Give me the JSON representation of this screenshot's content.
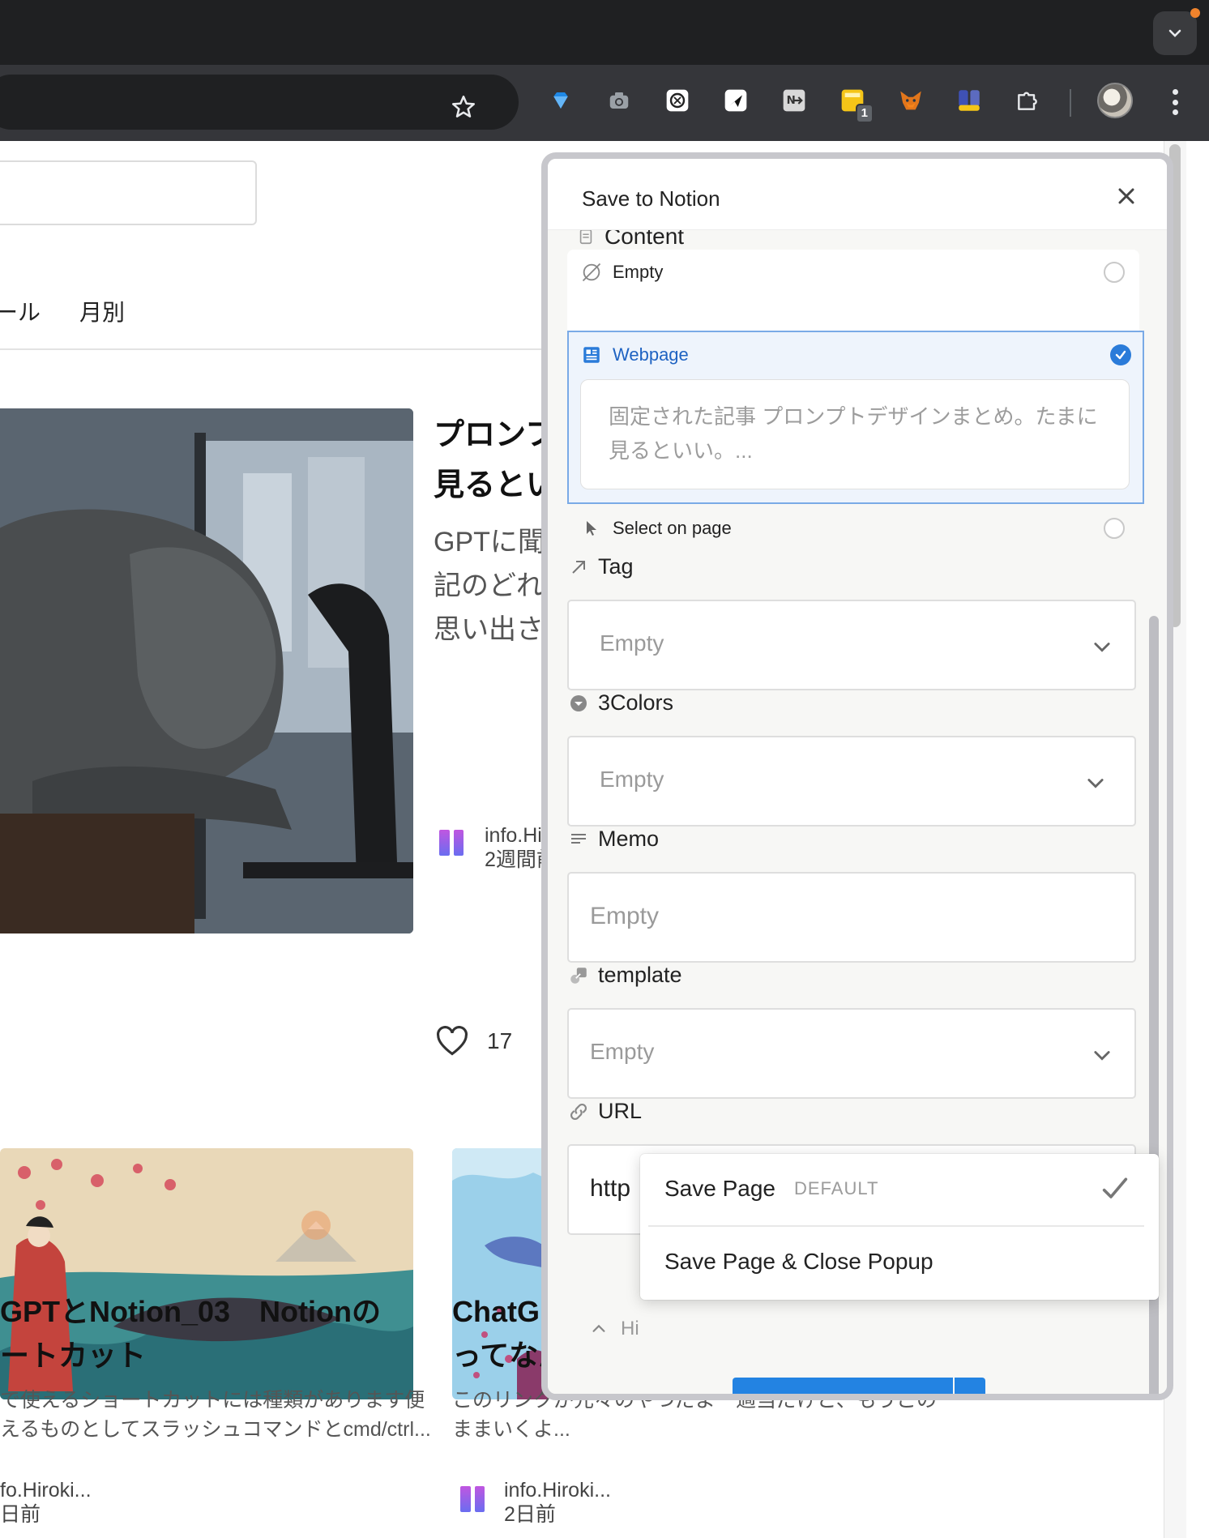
{
  "browser": {
    "tabs_menu_icon": "chevron-down-icon",
    "bookmark_icon": "star-icon",
    "extensions": [
      {
        "name": "gem-extension-icon",
        "badge": ""
      },
      {
        "name": "camera-extension-icon",
        "badge": ""
      },
      {
        "name": "chatgpt-extension-icon",
        "badge": ""
      },
      {
        "name": "send-extension-icon",
        "badge": ""
      },
      {
        "name": "notion-extension-icon",
        "badge": ""
      },
      {
        "name": "notes-extension-icon",
        "badge": "1"
      },
      {
        "name": "metamask-extension-icon",
        "badge": ""
      },
      {
        "name": "people-extension-icon",
        "badge": ""
      },
      {
        "name": "puzzle-extensions-icon",
        "badge": ""
      }
    ]
  },
  "page": {
    "nav": [
      "ール",
      "月別"
    ],
    "featured": {
      "title_lines": [
        "プロンフ",
        "見るとい"
      ],
      "desc_lines": [
        "GPTに聞",
        "記のどれ",
        "思い出さ"
      ],
      "author": "info.Hir",
      "date": "2週間前",
      "likes": "17"
    },
    "cards": [
      {
        "title_lines": [
          "GPTとNotion_03　Notionの",
          "ートカット"
        ],
        "desc_lines": [
          "で使えるショートカットには種類があります便",
          "えるものとしてスラッシュコマンドとcmd/ctrl..."
        ],
        "author": "fo.Hiroki...",
        "date": "日前"
      },
      {
        "title_lines": [
          "ChatGI",
          "ってなん"
        ],
        "desc_lines": [
          "このリンクが元々のやつだよー適当だけど、もうこの",
          "ままいくよ..."
        ],
        "author": "info.Hiroki...",
        "date": "2日前"
      }
    ]
  },
  "popup": {
    "title": "Save to Notion",
    "content_label": "Content",
    "options": {
      "empty": "Empty",
      "webpage": "Webpage",
      "webpage_text": "固定された記事 プロンプトデザインまとめ。たまに見るといい。...",
      "select": "Select on page"
    },
    "fields": {
      "tag": {
        "label": "Tag",
        "placeholder": "Empty"
      },
      "colors": {
        "label": "3Colors",
        "placeholder": "Empty"
      },
      "memo": {
        "label": "Memo",
        "placeholder": "Empty"
      },
      "template": {
        "label": "template",
        "placeholder": "Empty"
      },
      "url": {
        "label": "URL",
        "value": "http"
      }
    },
    "hide_label": "Hi",
    "save_button": "Save Page",
    "dropdown": {
      "option1": "Save Page",
      "option1_tag": "DEFAULT",
      "option2": "Save Page & Close Popup"
    },
    "accent_color": "#2383e2"
  }
}
